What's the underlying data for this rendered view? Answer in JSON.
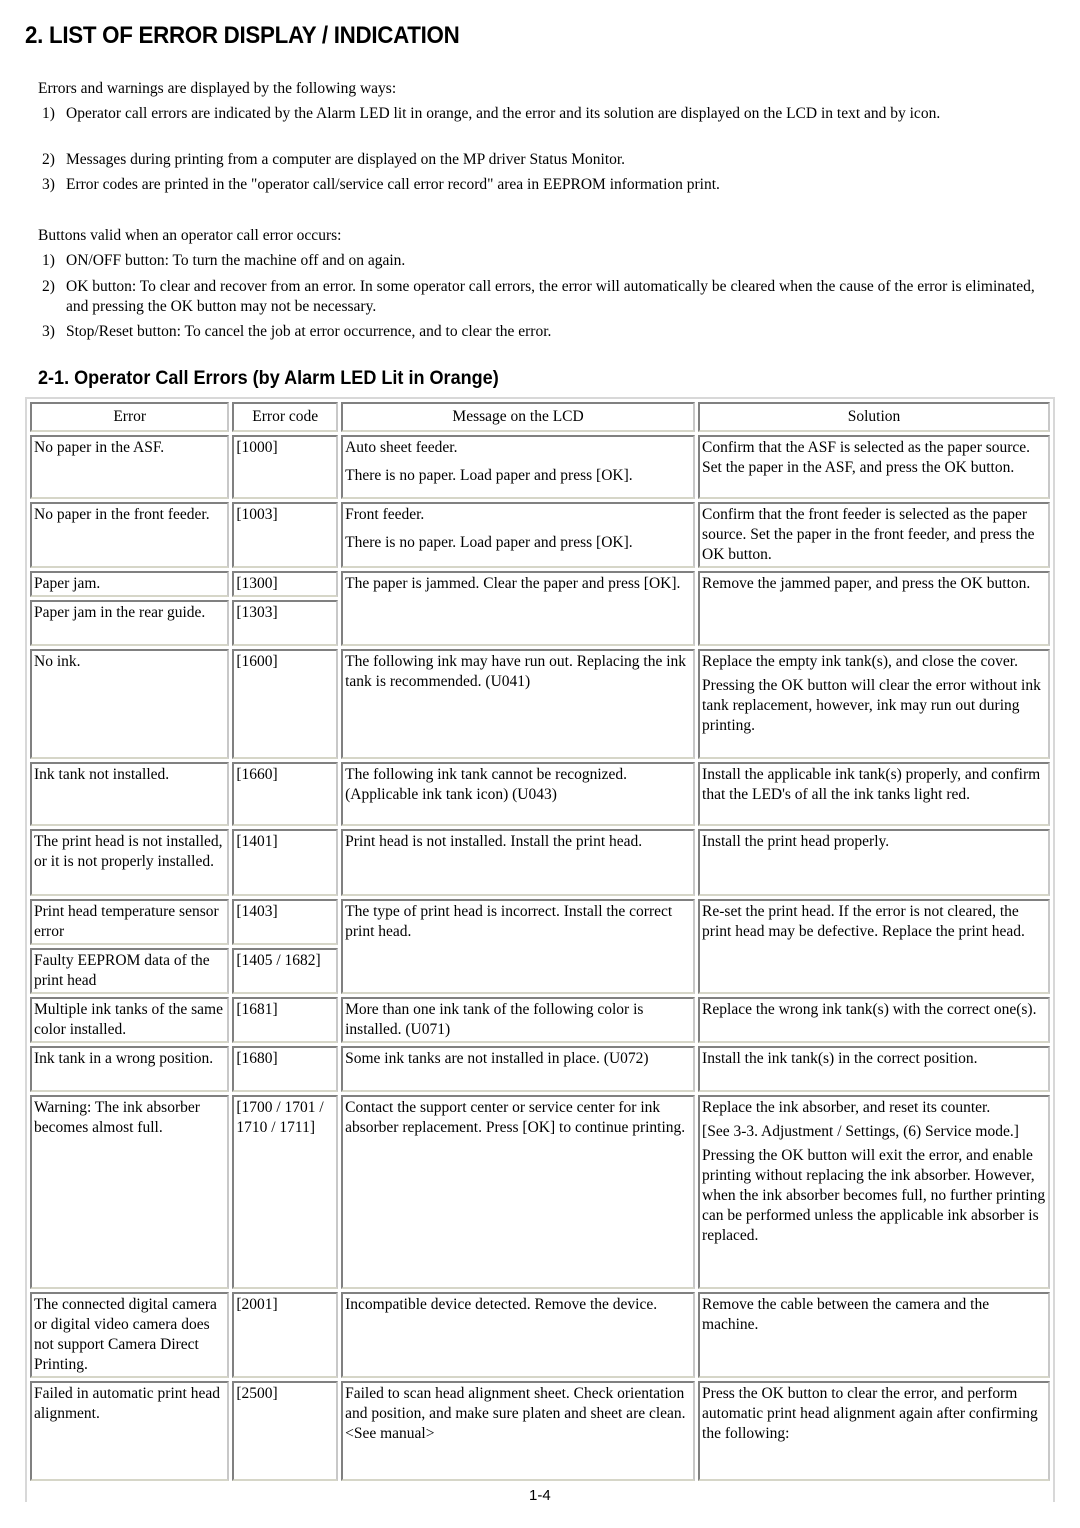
{
  "title": "2.  LIST OF ERROR DISPLAY / INDICATION",
  "intro": "Errors and warnings are displayed by the following ways:",
  "display_ways": [
    {
      "num": "1)",
      "text": "Operator call errors are indicated by the Alarm LED lit in orange, and the error and its solution are displayed on the LCD in text and by icon."
    },
    {
      "num": "2)",
      "text": "Messages during printing from a computer are displayed on the MP driver Status Monitor."
    },
    {
      "num": "3)",
      "text": "Error codes are printed in the \"operator call/service call error record\" area in EEPROM information print."
    }
  ],
  "buttons_intro": "Buttons valid when an operator call error occurs:",
  "buttons": [
    {
      "num": "1)",
      "text": "ON/OFF button:  To turn the machine off and on again."
    },
    {
      "num": "2)",
      "text": "OK button:  To clear and recover from an error. In some operator call errors, the error will automatically be cleared when the cause of the error is eliminated, and pressing the OK button may not be necessary."
    },
    {
      "num": "3)",
      "text": "Stop/Reset button:  To cancel the job at error occurrence, and to clear the error."
    }
  ],
  "section_title": "2-1.  Operator Call Errors (by Alarm LED Lit in Orange)",
  "table": {
    "headers": [
      "Error",
      "Error code",
      "Message on the LCD",
      "Solution"
    ],
    "rows": [
      {
        "error": "No paper in the ASF.",
        "code": "[1000]",
        "message": [
          "Auto sheet feeder.",
          "There is no paper. Load paper and press [OK]."
        ],
        "solution": [
          "Confirm that the ASF is selected as the paper source. Set the paper in the ASF, and press the OK button."
        ]
      },
      {
        "error": "No paper in the front feeder.",
        "code": "[1003]",
        "message": [
          "Front feeder.",
          "There is no paper. Load paper and press [OK]."
        ],
        "solution": [
          "Confirm that the front feeder is selected as the paper source. Set the paper in the front feeder, and press the OK button."
        ]
      },
      {
        "error": "Paper jam.",
        "code": "[1300]",
        "message": [
          "The paper is jammed. Clear the paper and press [OK]."
        ],
        "solution": [
          "Remove the jammed paper, and press the OK button."
        ]
      },
      {
        "error": "Paper jam in the rear guide.",
        "code": "[1303]"
      },
      {
        "error": "No ink.",
        "code": "[1600]",
        "message": [
          "The following ink may have run out. Replacing the ink tank is recommended. (U041)"
        ],
        "solution": [
          "Replace the empty ink tank(s), and close the cover.",
          "Pressing the OK button will clear the error without ink tank replacement, however, ink may run out during printing."
        ]
      },
      {
        "error": "Ink tank not installed.",
        "code": "[1660]",
        "message": [
          "The following ink tank cannot be recognized. (Applicable ink tank icon) (U043)"
        ],
        "solution": [
          "Install the applicable ink tank(s) properly, and confirm that the LED's of all the ink tanks light red."
        ]
      },
      {
        "error": "The print head is not installed, or it is not properly installed.",
        "code": "[1401]",
        "message": [
          "Print head is not installed. Install the print head."
        ],
        "solution": [
          "Install the print head properly."
        ]
      },
      {
        "error": "Print head temperature sensor error",
        "code": "[1403]",
        "message": [
          "The type of print head is incorrect. Install the correct print head."
        ],
        "solution": [
          "Re-set the print head. If the error is not cleared, the print head may be defective. Replace the print head."
        ]
      },
      {
        "error": "Faulty EEPROM data of the print head",
        "code": "[1405 / 1682]"
      },
      {
        "error": "Multiple ink tanks of the same color installed.",
        "code": "[1681]",
        "message": [
          "More than one ink tank of the following color is installed. (U071)"
        ],
        "solution": [
          "Replace the wrong ink tank(s) with the correct one(s)."
        ]
      },
      {
        "error": "Ink tank in a wrong position.",
        "code": "[1680]",
        "message": [
          "Some ink tanks are not installed in place. (U072)"
        ],
        "solution": [
          "Install the ink tank(s) in the correct position."
        ]
      },
      {
        "error": "Warning:  The ink absorber becomes almost full.",
        "code": "[1700 / 1701 / 1710 / 1711]",
        "message": [
          "Contact the support center or service center for ink absorber replacement. Press [OK] to continue printing."
        ],
        "solution": [
          "Replace the ink absorber, and reset its counter.",
          "[See 3-3. Adjustment / Settings, (6) Service mode.]",
          "Pressing the OK button will exit the error, and enable printing without replacing the ink absorber. However, when the ink absorber becomes full, no further printing can be performed unless the applicable ink absorber is replaced."
        ]
      },
      {
        "error": "The connected digital camera or digital video camera does not support Camera Direct Printing.",
        "code": "[2001]",
        "message": [
          "Incompatible device detected. Remove the device."
        ],
        "solution": [
          "Remove the cable between the camera and the machine."
        ]
      },
      {
        "error": "Failed in automatic print head alignment.",
        "code": "[2500]",
        "message": [
          "Failed to scan head alignment sheet. Check orientation and position, and make sure platen and sheet are clean. <See manual>"
        ],
        "solution": [
          "Press the OK button to clear the error, and perform  automatic print head alignment again after confirming the following:"
        ]
      }
    ]
  },
  "page_number": "1-4"
}
